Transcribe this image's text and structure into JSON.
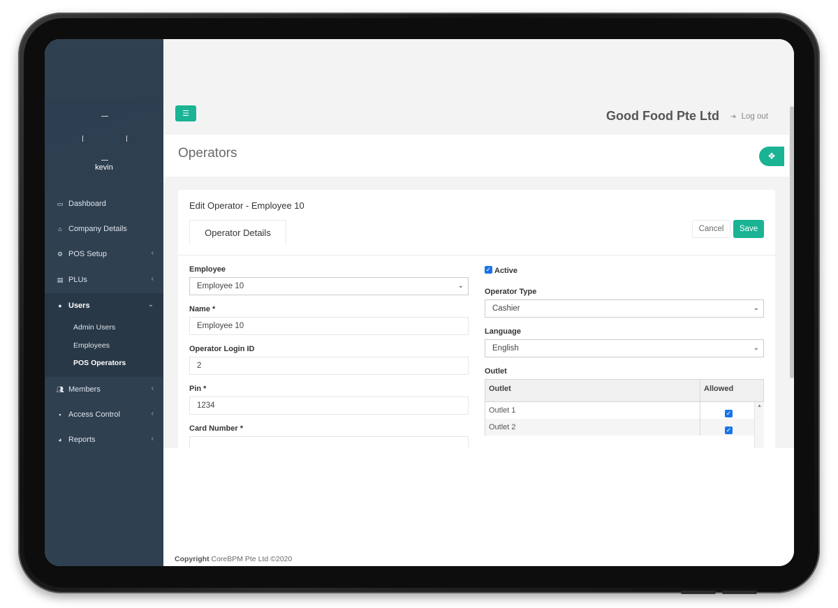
{
  "sidebar": {
    "user_name": "kevin",
    "items": [
      {
        "label": "Dashboard",
        "icon": "monitor-icon"
      },
      {
        "label": "Company Details",
        "icon": "home-icon"
      },
      {
        "label": "POS Setup",
        "icon": "gear-icon"
      },
      {
        "label": "PLUs",
        "icon": "book-icon"
      },
      {
        "label": "Users",
        "icon": "user-icon"
      },
      {
        "label": "Members",
        "icon": "users-icon"
      },
      {
        "label": "Access Control",
        "icon": "lock-icon"
      },
      {
        "label": "Reports",
        "icon": "pie-chart-icon"
      }
    ],
    "users_sub": [
      "Admin Users",
      "Employees",
      "POS Operators"
    ]
  },
  "header": {
    "company": "Good Food Pte Ltd",
    "logout": "Log out"
  },
  "page": {
    "title": "Operators"
  },
  "form": {
    "card_title": "Edit Operator - Employee 10",
    "tab_label": "Operator Details",
    "cancel_label": "Cancel",
    "save_label": "Save",
    "employee_label": "Employee",
    "employee_value": "Employee 10",
    "name_label": "Name *",
    "name_value": "Employee 10",
    "login_label": "Operator Login ID",
    "login_value": "2",
    "pin_label": "Pin *",
    "pin_value": "1234",
    "card_label": "Card Number *",
    "active_label": "Active",
    "active_checked": true,
    "operator_type_label": "Operator Type",
    "operator_type_value": "Cashier",
    "language_label": "Language",
    "language_value": "English",
    "outlet_label": "Outlet",
    "outlet_col": "Outlet",
    "allowed_col": "Allowed",
    "outlets": [
      {
        "name": "Outlet 1",
        "allowed": true
      },
      {
        "name": "Outlet 2",
        "allowed": true
      }
    ]
  },
  "footer": {
    "copyright_bold": "Copyright",
    "copyright_text": "CoreBPM Pte Ltd ©2020"
  },
  "colors": {
    "sidebar": "#2f4050",
    "accent": "#1ab394",
    "checkbox": "#1a73e8"
  }
}
